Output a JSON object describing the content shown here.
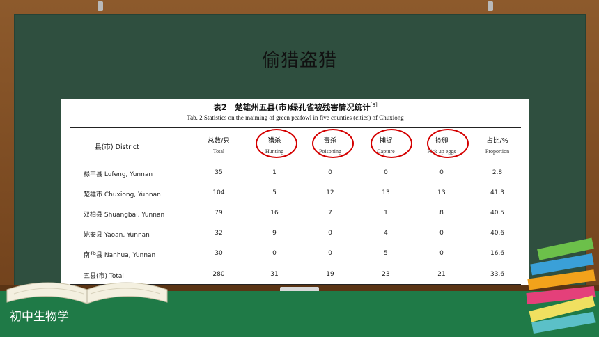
{
  "slide": {
    "title": "偷猎盗猎",
    "footer": "初中生物学"
  },
  "table": {
    "caption_cn": "表2　楚雄州五县(市)绿孔雀被残害情况统计",
    "caption_ref": "[8]",
    "caption_en": "Tab. 2 Statistics on the maiming of green peafowl in five counties (cities) of Chuxiong",
    "headers": [
      {
        "cn": "县(市) District",
        "en": ""
      },
      {
        "cn": "总数/只",
        "en": "Total"
      },
      {
        "cn": "猎杀",
        "en": "Hunting"
      },
      {
        "cn": "毒杀",
        "en": "Poisoning"
      },
      {
        "cn": "捕捉",
        "en": "Capture"
      },
      {
        "cn": "捡卵",
        "en": "Pick up eggs"
      },
      {
        "cn": "占比/%",
        "en": "Proportion"
      }
    ],
    "rows": [
      [
        "禄丰县 Lufeng, Yunnan",
        "35",
        "1",
        "0",
        "0",
        "0",
        "2.8"
      ],
      [
        "楚雄市 Chuxiong, Yunnan",
        "104",
        "5",
        "12",
        "13",
        "13",
        "41.3"
      ],
      [
        "双柏县 Shuangbai, Yunnan",
        "79",
        "16",
        "7",
        "1",
        "8",
        "40.5"
      ],
      [
        "姚安县 Yaoan, Yunnan",
        "32",
        "9",
        "0",
        "4",
        "0",
        "40.6"
      ],
      [
        "南华县 Nanhua, Yunnan",
        "30",
        "0",
        "0",
        "5",
        "0",
        "16.6"
      ],
      [
        "五县(市) Total",
        "280",
        "31",
        "19",
        "23",
        "21",
        "33.6"
      ]
    ]
  },
  "colors": {
    "board": "#2f4f3f",
    "frame": "#7a4a22",
    "band": "#1f7a47",
    "highlight_circle": "#d40000"
  }
}
